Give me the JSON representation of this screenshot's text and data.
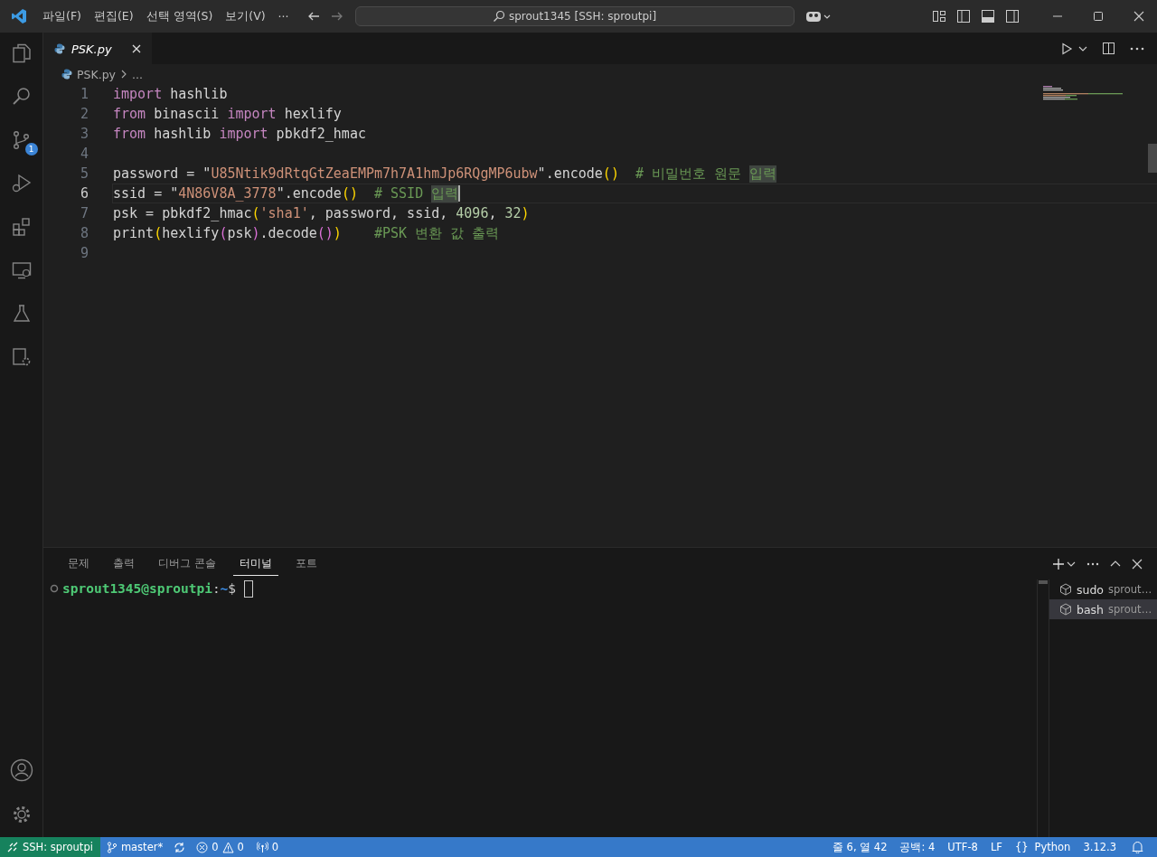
{
  "title_bar": {
    "menus": [
      "파일(F)",
      "편집(E)",
      "선택 영역(S)",
      "보기(V)",
      "···"
    ],
    "search": "sprout1345 [SSH: sproutpi]"
  },
  "activity_bar": {
    "source_control_badge": "1"
  },
  "tabs": [
    {
      "label": "PSK.py",
      "selected": true,
      "preview": true
    }
  ],
  "breadcrumbs": [
    "PSK.py",
    "..."
  ],
  "editor": {
    "lines": [
      {
        "number": "1",
        "current": false,
        "tokens": [
          {
            "text": "import",
            "kind": "keyword"
          },
          {
            "text": " hashlib",
            "kind": "plain"
          }
        ]
      },
      {
        "number": "2",
        "current": false,
        "tokens": [
          {
            "text": "from",
            "kind": "keyword"
          },
          {
            "text": " binascii ",
            "kind": "plain"
          },
          {
            "text": "import",
            "kind": "keyword"
          },
          {
            "text": " hexlify",
            "kind": "plain"
          }
        ]
      },
      {
        "number": "3",
        "current": false,
        "tokens": [
          {
            "text": "from",
            "kind": "keyword"
          },
          {
            "text": " hashlib ",
            "kind": "plain"
          },
          {
            "text": "import",
            "kind": "keyword"
          },
          {
            "text": " pbkdf2_hmac",
            "kind": "plain"
          }
        ]
      },
      {
        "number": "4",
        "current": false
      },
      {
        "number": "5",
        "current": false,
        "tokens": [
          {
            "text": "password = \"",
            "kind": "plain"
          },
          {
            "text": "U85Ntik9dRtqGtZeaEMPm7h7A1hmJp6RQgMP6ubw",
            "kind": "string"
          },
          {
            "text": "\".encode",
            "kind": "plain"
          },
          {
            "text": "()",
            "kind": "bracket1"
          },
          {
            "text": "  # 비밀번호 원문 ",
            "kind": "comment"
          },
          {
            "text": "입력",
            "kind": "comment_match"
          }
        ]
      },
      {
        "number": "6",
        "current": true,
        "tokens": [
          {
            "text": "ssid = \"",
            "kind": "plain"
          },
          {
            "text": "4N86V8A_3778",
            "kind": "string"
          },
          {
            "text": "\".encode",
            "kind": "plain"
          },
          {
            "text": "()",
            "kind": "bracket1"
          },
          {
            "text": "  # SSID ",
            "kind": "comment"
          },
          {
            "text": "입력",
            "kind": "comment_match"
          }
        ]
      },
      {
        "number": "7",
        "current": false,
        "tokens": [
          {
            "text": "psk = pbkdf2_hmac",
            "kind": "plain"
          },
          {
            "text": "(",
            "kind": "bracket1"
          },
          {
            "text": "'sha1'",
            "kind": "string"
          },
          {
            "text": ", password, ssid, ",
            "kind": "plain"
          },
          {
            "text": "4096",
            "kind": "number"
          },
          {
            "text": ", ",
            "kind": "plain"
          },
          {
            "text": "32",
            "kind": "number"
          },
          {
            "text": ")",
            "kind": "bracket1"
          }
        ]
      },
      {
        "number": "8",
        "current": false,
        "tokens": [
          {
            "text": "print",
            "kind": "plain"
          },
          {
            "text": "(",
            "kind": "bracket1"
          },
          {
            "text": "hexlify",
            "kind": "plain"
          },
          {
            "text": "(",
            "kind": "bracket2"
          },
          {
            "text": "psk",
            "kind": "plain"
          },
          {
            "text": ")",
            "kind": "bracket2"
          },
          {
            "text": ".decode",
            "kind": "plain"
          },
          {
            "text": "()",
            "kind": "bracket2"
          },
          {
            "text": ")",
            "kind": "bracket1"
          },
          {
            "text": "    #PSK 변환 값 출력",
            "kind": "comment"
          }
        ]
      },
      {
        "number": "9",
        "current": false
      }
    ]
  },
  "panel": {
    "tabs": [
      {
        "label": "문제",
        "selected": false
      },
      {
        "label": "출력",
        "selected": false
      },
      {
        "label": "디버그 콘솔",
        "selected": false
      },
      {
        "label": "터미널",
        "selected": true
      },
      {
        "label": "포트",
        "selected": false
      }
    ],
    "terminal": {
      "user_host": "sprout1345@sproutpi",
      "colon": ":",
      "path": "~",
      "prompt": "$"
    },
    "terminals": [
      {
        "name": "sudo",
        "detail": "sprout…",
        "selected": false
      },
      {
        "name": "bash",
        "detail": "sprout…",
        "selected": true
      }
    ]
  },
  "status_bar": {
    "remote": "SSH: sproutpi",
    "branch": "master*",
    "errors": "0",
    "warnings": "0",
    "ports": "0",
    "position": "줄 6, 열 42",
    "indent": "공백: 4",
    "encoding": "UTF-8",
    "eol": "LF",
    "language_icon": "{}",
    "language": "Python",
    "version": "3.12.3"
  }
}
